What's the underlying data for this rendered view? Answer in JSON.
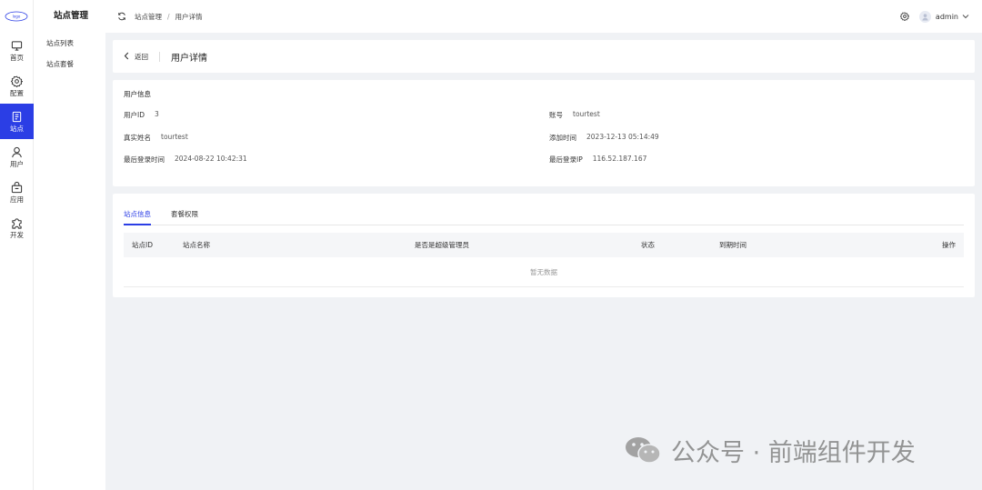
{
  "app": {
    "logo_alt": "logo"
  },
  "rail": {
    "items": [
      {
        "label": "首页",
        "icon": "monitor-icon"
      },
      {
        "label": "配置",
        "icon": "gear-icon"
      },
      {
        "label": "站点",
        "icon": "document-icon",
        "active": true
      },
      {
        "label": "用户",
        "icon": "user-icon"
      },
      {
        "label": "应用",
        "icon": "bag-icon"
      },
      {
        "label": "开发",
        "icon": "puzzle-icon"
      }
    ]
  },
  "submenu": {
    "title": "站点管理",
    "items": [
      {
        "label": "站点列表"
      },
      {
        "label": "站点套餐"
      }
    ]
  },
  "header": {
    "breadcrumb": [
      "站点管理",
      "用户详情"
    ],
    "separator": "/",
    "username": "admin"
  },
  "page": {
    "back_label": "返回",
    "title": "用户详情"
  },
  "user_info": {
    "section_title": "用户信息",
    "fields": {
      "user_id": {
        "label": "用户ID",
        "value": "3"
      },
      "account": {
        "label": "账号",
        "value": "tourtest"
      },
      "real_name": {
        "label": "真实姓名",
        "value": "tourtest"
      },
      "created_at": {
        "label": "添加时间",
        "value": "2023-12-13 05:14:49"
      },
      "last_login_time": {
        "label": "最后登录时间",
        "value": "2024-08-22 10:42:31"
      },
      "last_login_ip": {
        "label": "最后登录IP",
        "value": "116.52.187.167"
      }
    }
  },
  "tabs": [
    {
      "label": "站点信息",
      "active": true
    },
    {
      "label": "套餐权限",
      "active": false
    }
  ],
  "table": {
    "columns": [
      "站点ID",
      "站点名称",
      "是否是超级管理员",
      "状态",
      "到期时间",
      "操作"
    ],
    "empty_text": "暂无数据"
  },
  "watermark": {
    "text": "公众号 · 前端组件开发"
  },
  "colors": {
    "accent": "#2b3ee5",
    "background": "#f0f2f5"
  }
}
